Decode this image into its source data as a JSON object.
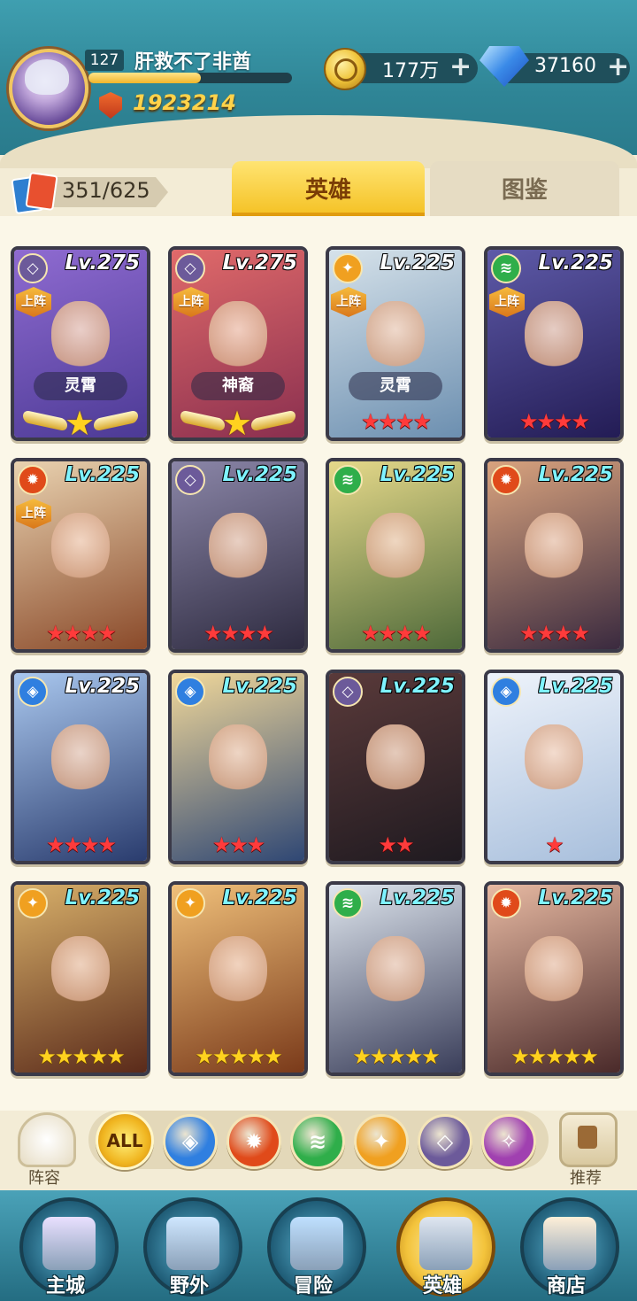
{
  "player": {
    "level": "127",
    "name": "肝救不了非酋",
    "exp_fraction": 0.55,
    "power": "1923214"
  },
  "resources": {
    "gold": "177万",
    "gems": "37160",
    "plus": "+"
  },
  "collection": {
    "count": "351/625"
  },
  "tabs": {
    "active": "英雄",
    "inactive": "图鉴"
  },
  "heroes": [
    {
      "level": "Lv.275",
      "faction": "dark",
      "deployed": "上阵",
      "title": "灵霄",
      "stars": 1,
      "star_color": "gold-wing",
      "art": [
        "#8f6bd1",
        "#4c3a95"
      ]
    },
    {
      "level": "Lv.275",
      "faction": "dark",
      "deployed": "上阵",
      "title": "神裔",
      "stars": 1,
      "star_color": "gold-wing",
      "art": [
        "#e06a6a",
        "#8a2f4f"
      ]
    },
    {
      "level": "Lv.225",
      "faction": "light",
      "deployed": "上阵",
      "title": "灵霄",
      "stars": 4,
      "star_color": "red",
      "art": [
        "#d6e2ea",
        "#6c8fb0"
      ]
    },
    {
      "level": "Lv.225",
      "faction": "nature",
      "deployed": "上阵",
      "title": "",
      "stars": 4,
      "star_color": "red",
      "art": [
        "#5e5aa8",
        "#231c55"
      ]
    },
    {
      "level": "Lv.225",
      "faction": "fire",
      "deployed": "上阵",
      "title": "",
      "stars": 4,
      "star_color": "red",
      "art": [
        "#e9d2b0",
        "#8a4a2a"
      ]
    },
    {
      "level": "Lv.225",
      "faction": "dark",
      "deployed": "",
      "title": "",
      "stars": 4,
      "star_color": "red",
      "art": [
        "#8b86a8",
        "#2e2b40"
      ]
    },
    {
      "level": "Lv.225",
      "faction": "nature",
      "deployed": "",
      "title": "",
      "stars": 4,
      "star_color": "red",
      "art": [
        "#e6d98a",
        "#4f6a3a"
      ]
    },
    {
      "level": "Lv.225",
      "faction": "fire",
      "deployed": "",
      "title": "",
      "stars": 4,
      "star_color": "red",
      "art": [
        "#d9a37e",
        "#3a2a3f"
      ]
    },
    {
      "level": "Lv.225",
      "faction": "water",
      "deployed": "",
      "title": "",
      "stars": 4,
      "star_color": "red",
      "art": [
        "#a9c7ee",
        "#2a3c6e"
      ]
    },
    {
      "level": "Lv.225",
      "faction": "water",
      "deployed": "",
      "title": "",
      "stars": 3,
      "star_color": "red",
      "art": [
        "#f1d89a",
        "#2f4774"
      ]
    },
    {
      "level": "Lv.225",
      "faction": "dark",
      "deployed": "",
      "title": "",
      "stars": 2,
      "star_color": "red",
      "art": [
        "#5a3a3a",
        "#1f1a20"
      ]
    },
    {
      "level": "Lv.225",
      "faction": "water",
      "deployed": "",
      "title": "",
      "stars": 1,
      "star_color": "red",
      "art": [
        "#eef3fb",
        "#a8bfdc"
      ]
    },
    {
      "level": "Lv.225",
      "faction": "light",
      "deployed": "",
      "title": "",
      "stars": 5,
      "star_color": "yellow",
      "art": [
        "#d8b06a",
        "#5a2a1a"
      ]
    },
    {
      "level": "Lv.225",
      "faction": "light",
      "deployed": "",
      "title": "",
      "stars": 5,
      "star_color": "yellow",
      "art": [
        "#f0c07a",
        "#7a3a1a"
      ]
    },
    {
      "level": "Lv.225",
      "faction": "nature",
      "deployed": "",
      "title": "",
      "stars": 5,
      "star_color": "yellow",
      "art": [
        "#dfe6ee",
        "#3a3e5a"
      ]
    },
    {
      "level": "Lv.225",
      "faction": "fire",
      "deployed": "",
      "title": "",
      "stars": 5,
      "star_color": "yellow",
      "art": [
        "#e7b9a2",
        "#4a2a2a"
      ]
    }
  ],
  "filters": {
    "lineup_label": "阵容",
    "all_label": "ALL",
    "recommend_label": "推荐",
    "factions": [
      {
        "name": "water",
        "color": "#2f7fe0"
      },
      {
        "name": "fire",
        "color": "#e04a1a"
      },
      {
        "name": "nature",
        "color": "#2fae4a"
      },
      {
        "name": "light",
        "color": "#f0a020"
      },
      {
        "name": "dark",
        "color": "#6c5a9a"
      },
      {
        "name": "arcane",
        "color": "#a040b0"
      }
    ]
  },
  "nav": [
    {
      "label": "主城",
      "icon": "castle-icon",
      "active": false
    },
    {
      "label": "野外",
      "icon": "portal-icon",
      "active": false
    },
    {
      "label": "冒险",
      "icon": "sword-icon",
      "active": false
    },
    {
      "label": "英雄",
      "icon": "helmet-icon",
      "active": true
    },
    {
      "label": "商店",
      "icon": "shop-icon",
      "active": false
    }
  ],
  "faction_colors": {
    "water": "#2f7fe0",
    "fire": "#e04a1a",
    "nature": "#2fae4a",
    "light": "#f0a020",
    "dark": "#6c5a9a"
  },
  "faction_glyphs": {
    "water": "◈",
    "fire": "✹",
    "nature": "≋",
    "light": "✦",
    "dark": "◇"
  }
}
